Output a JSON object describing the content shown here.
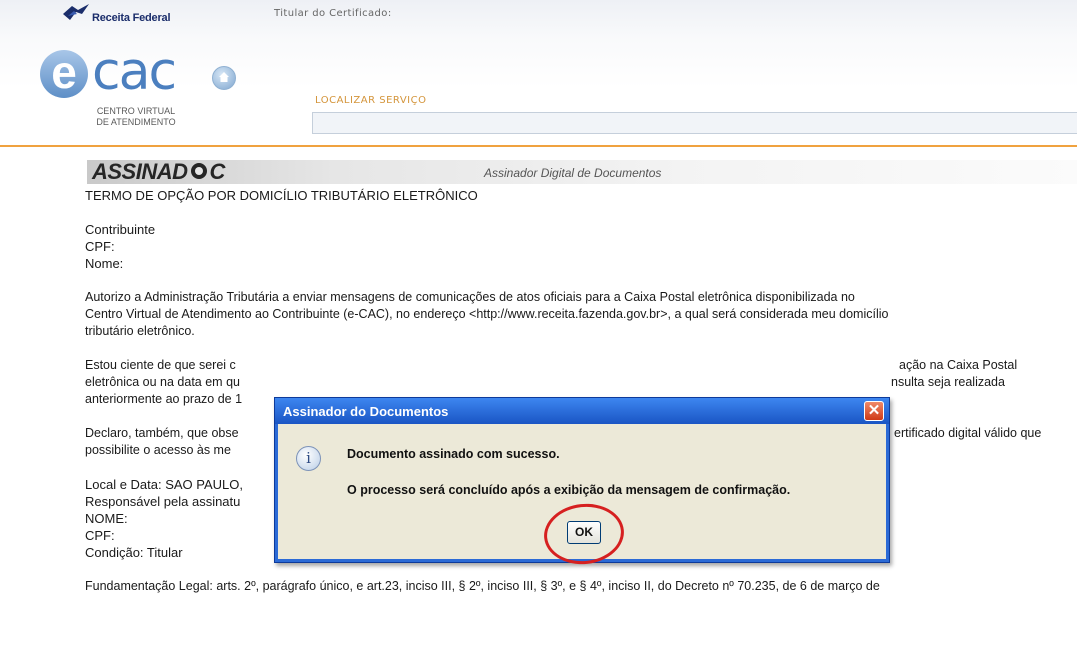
{
  "header": {
    "brand": "Receita Federal",
    "titular_label": "Titular do Certificado:",
    "ecac_logo_text": "cac",
    "ecac_subtitle_line1": "CENTRO VIRTUAL",
    "ecac_subtitle_line2": "DE ATENDIMENTO",
    "search_label": "LOCALIZAR SERVIÇO",
    "search_value": "",
    "accent_color": "#f0a23f"
  },
  "assinador": {
    "logo_text": "ASSINAD C",
    "subtitle": "Assinador Digital de Documentos"
  },
  "document": {
    "title": "TERMO DE OPÇÃO POR DOMICÍLIO TRIBUTÁRIO ELETRÔNICO",
    "contribuinte": "Contribuinte",
    "cpf": "CPF:",
    "nome": "Nome:",
    "para1_line1": "Autorizo a Administração Tributária a enviar mensagens de comunicações de atos oficiais para a Caixa Postal eletrônica disponibilizada no",
    "para1_line2": "Centro Virtual de Atendimento ao Contribuinte (e-CAC), no endereço <http://www.receita.fazenda.gov.br>, a qual será considerada  meu domicílio",
    "para1_line3": "tributário eletrônico.",
    "para2_line1_left": "Estou ciente de que serei c",
    "para2_line1_right": "ação na Caixa Postal",
    "para2_line2_left": "eletrônica ou na data em qu",
    "para2_line2_right": "nsulta seja realizada",
    "para2_line3_left": "anteriormente ao prazo de 1",
    "para3_line1_left": "Declaro, também, que obse",
    "para3_line1_right": "ertificado digital válido que",
    "para3_line2_left": "possibilite o acesso às me",
    "local_data": "Local e Data: SAO PAULO, ",
    "responsavel": "Responsável pela assinatu",
    "nome2": "NOME:",
    "cpf2": "CPF:",
    "condicao": "Condição: Titular",
    "fundamentacao": "Fundamentação Legal: arts. 2º, parágrafo único, e art.23, inciso III, § 2º, inciso III, § 3º, e § 4º, inciso II, do Decreto nº 70.235, de 6 de março de"
  },
  "dialog": {
    "title": "Assinador do Documentos",
    "close_glyph": "✕",
    "info_glyph": "i",
    "message1": "Documento assinado com sucesso.",
    "message2": "O processo será concluído após a exibição da mensagem de confirmação.",
    "ok_label": "OK",
    "titlebar_color": "#2b6ad6",
    "highlight_color": "#d62020"
  }
}
